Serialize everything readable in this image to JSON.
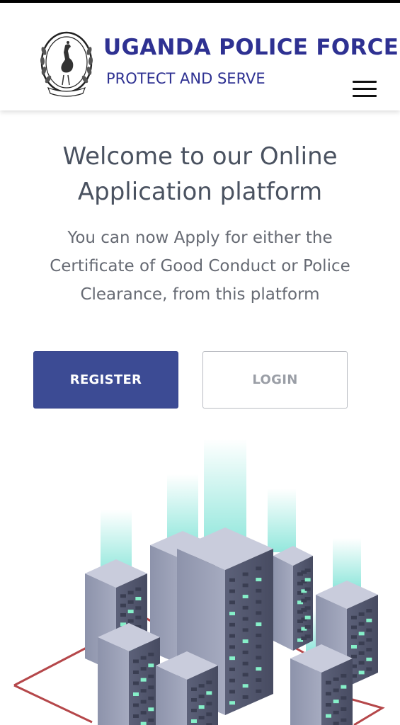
{
  "header": {
    "title": "UGANDA POLICE FORCE",
    "subtitle": "PROTECT AND SERVE",
    "logo_icon": "uganda-police-crest-icon",
    "menu_icon": "hamburger-menu-icon",
    "brand_color": "#2e3192"
  },
  "main": {
    "heading_line1": "Welcome to our Online",
    "heading_line2": "Application platform",
    "intro_line1": "You can now Apply for either the",
    "intro_line2": "Certificate of Good Conduct or Police",
    "intro_line3": "Clearance, from this platform"
  },
  "actions": {
    "register_label": "REGISTER",
    "login_label": "LOGIN",
    "register_color": "#3c4b94"
  },
  "illustration": {
    "icon": "server-rack-illustration"
  }
}
